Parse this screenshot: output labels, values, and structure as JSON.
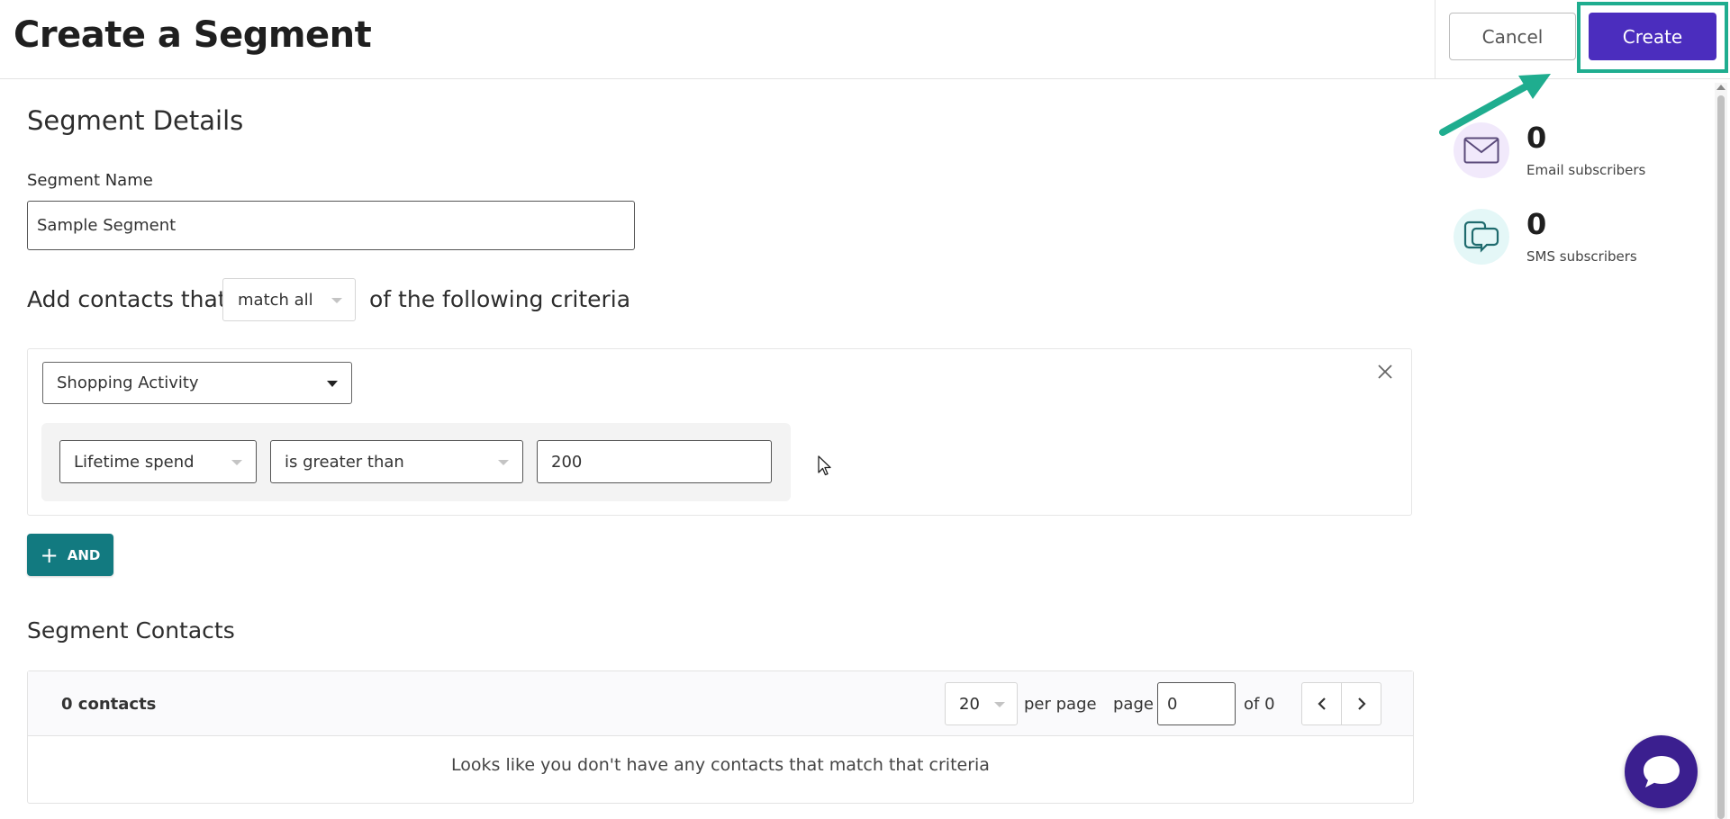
{
  "header": {
    "title": "Create a Segment",
    "cancel_label": "Cancel",
    "create_label": "Create"
  },
  "details": {
    "section_title": "Segment Details",
    "name_label": "Segment Name",
    "name_value": "Sample Segment",
    "criteria_prefix": "Add contacts that",
    "match_value": "match all",
    "criteria_suffix": "of the following criteria"
  },
  "criteria": {
    "category": "Shopping Activity",
    "rule": {
      "field": "Lifetime spend",
      "operator": "is greater than",
      "value": "200"
    },
    "and_label": "AND"
  },
  "contacts": {
    "section_title": "Segment Contacts",
    "count_label": "0 contacts",
    "per_page_value": "20",
    "per_page_label": "per page",
    "page_label": "page",
    "page_value": "0",
    "of_label": "of 0",
    "empty_message": "Looks like you don't have any contacts that match that criteria"
  },
  "stats": {
    "email": {
      "count": "0",
      "label": "Email subscribers",
      "icon": "envelope-icon"
    },
    "sms": {
      "count": "0",
      "label": "SMS subscribers",
      "icon": "chat-bubbles-icon"
    }
  },
  "colors": {
    "primary": "#4b2dbe",
    "teal": "#127a80",
    "highlight": "#1fad8f",
    "chat": "#3b1f8f"
  }
}
